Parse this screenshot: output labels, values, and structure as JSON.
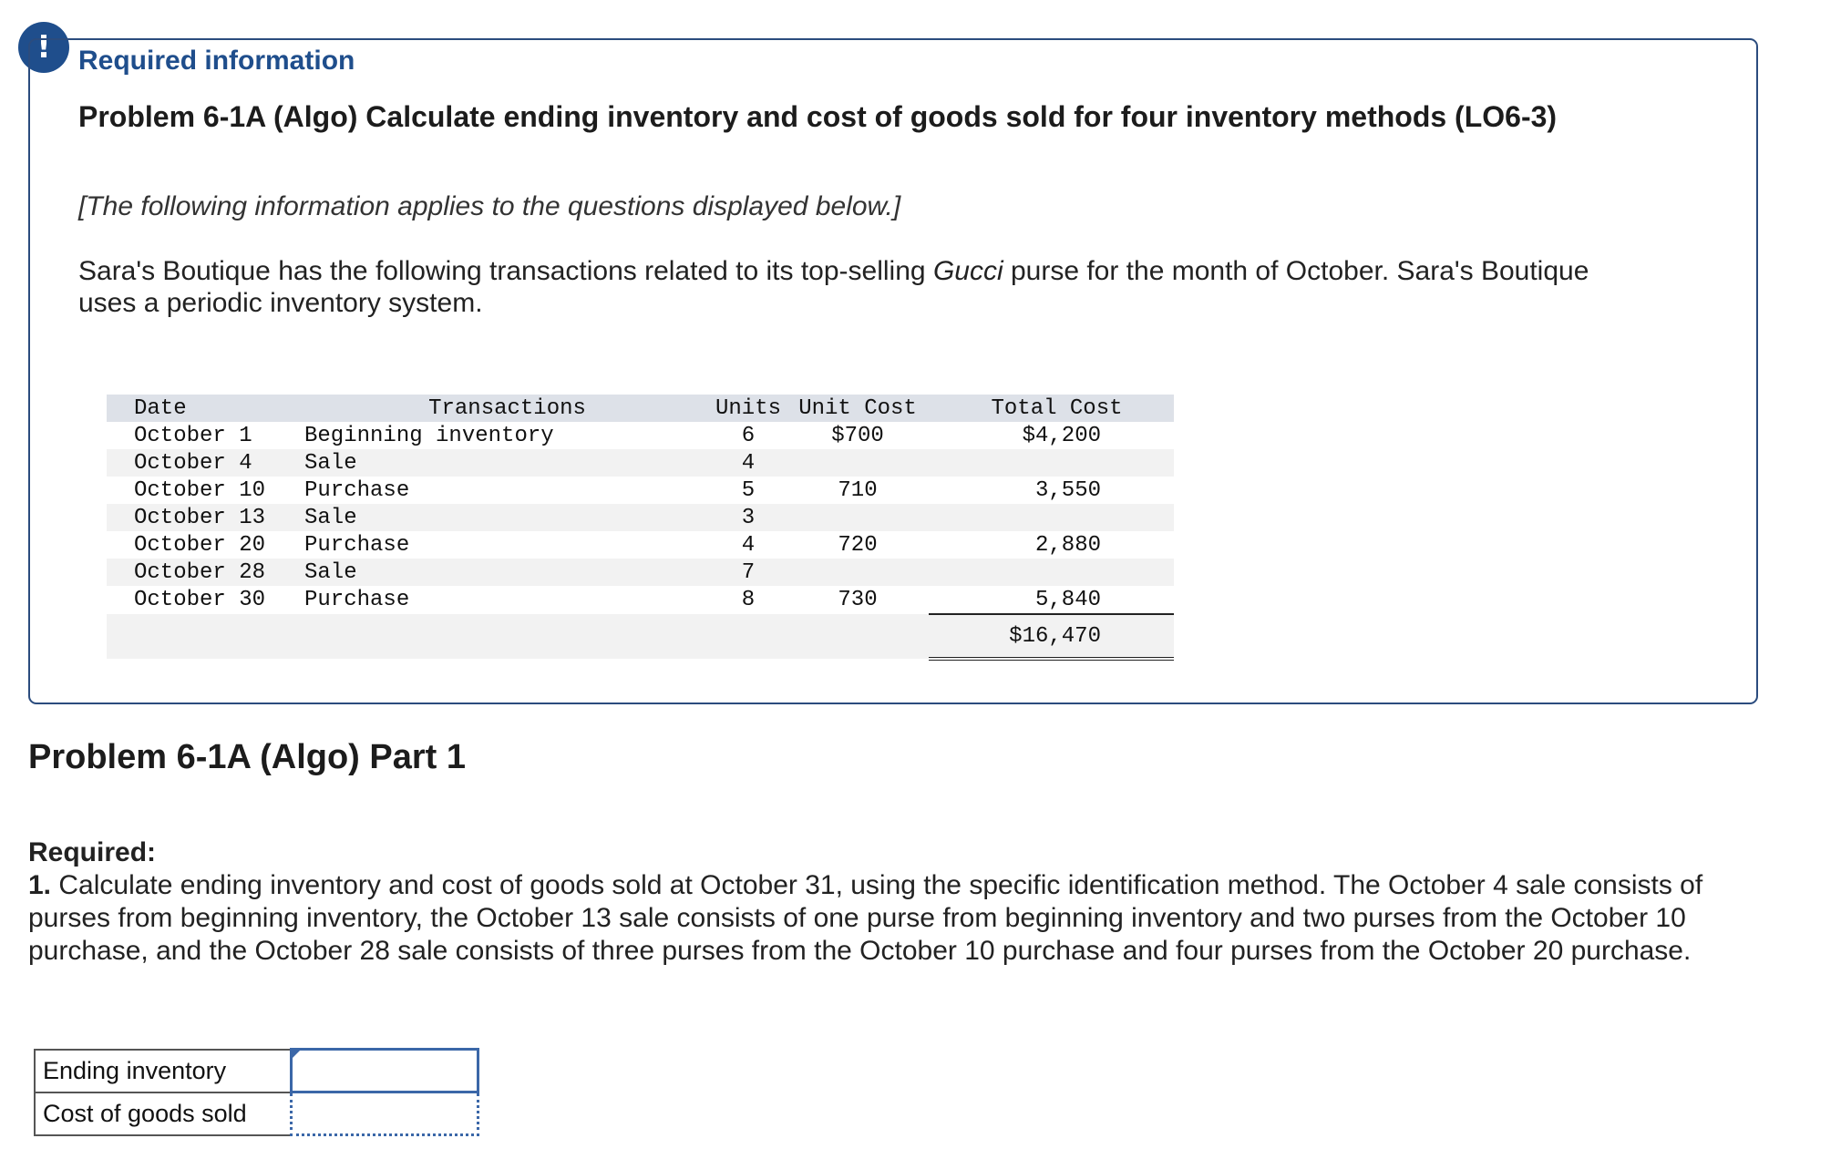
{
  "alert": {
    "glyph": "!"
  },
  "info": {
    "heading": "Required information",
    "problem_title": "Problem 6-1A (Algo) Calculate ending inventory and cost of goods sold for four inventory methods (LO6-3)",
    "note": "[The following information applies to the questions displayed below.]",
    "intro_before": "Sara's Boutique has the following transactions related to its top-selling ",
    "intro_brand": "Gucci",
    "intro_after": " purse for the month of October. Sara's Boutique uses a periodic inventory system."
  },
  "table": {
    "headers": {
      "date": "Date",
      "transactions": "Transactions",
      "units": "Units",
      "unit_cost": "Unit Cost",
      "total_cost": "Total Cost"
    },
    "rows": [
      {
        "date": "October 1",
        "transaction": "Beginning inventory",
        "units": "6",
        "unit_cost": "$700",
        "total_cost": "$4,200"
      },
      {
        "date": "October 4",
        "transaction": "Sale",
        "units": "4",
        "unit_cost": "",
        "total_cost": ""
      },
      {
        "date": "October 10",
        "transaction": "Purchase",
        "units": "5",
        "unit_cost": "710",
        "total_cost": "3,550"
      },
      {
        "date": "October 13",
        "transaction": "Sale",
        "units": "3",
        "unit_cost": "",
        "total_cost": ""
      },
      {
        "date": "October 20",
        "transaction": "Purchase",
        "units": "4",
        "unit_cost": "720",
        "total_cost": "2,880"
      },
      {
        "date": "October 28",
        "transaction": "Sale",
        "units": "7",
        "unit_cost": "",
        "total_cost": ""
      },
      {
        "date": "October 30",
        "transaction": "Purchase",
        "units": "8",
        "unit_cost": "730",
        "total_cost": "5,840"
      }
    ],
    "grand_total": "$16,470"
  },
  "part": {
    "title": "Problem 6-1A (Algo) Part 1"
  },
  "required": {
    "label": "Required:",
    "number": "1.",
    "text": " Calculate ending inventory and cost of goods sold at October 31, using the specific identification method. The October 4 sale consists of purses from beginning inventory, the October 13 sale consists of one purse from beginning inventory and two purses from the October 10 purchase, and the October 28 sale consists of three purses from the October 10 purchase and four purses from the October 20 purchase."
  },
  "answers": {
    "ending_inventory_label": "Ending inventory",
    "ending_inventory_value": "",
    "cogs_label": "Cost of goods sold",
    "cogs_value": ""
  }
}
